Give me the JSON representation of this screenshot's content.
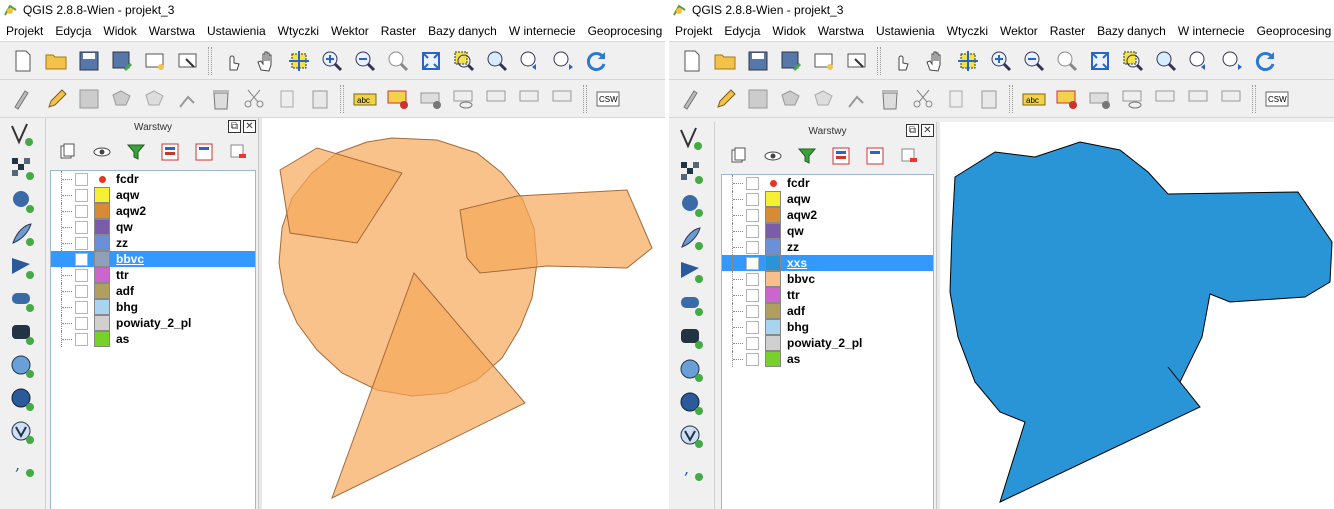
{
  "windows": [
    {
      "title": "QGIS 2.8.8-Wien - projekt_3",
      "menu": [
        "Projekt",
        "Edycja",
        "Widok",
        "Warstwa",
        "Ustawienia",
        "Wtyczki",
        "Wektor",
        "Raster",
        "Bazy danych",
        "W internecie",
        "Geoprocesing",
        "Po"
      ],
      "panel_title": "Warstwy",
      "toolbar_label": "CSW",
      "layers": [
        {
          "name": "fcdr",
          "type": "point",
          "color": "#e8351c",
          "checked": false,
          "selected": false
        },
        {
          "name": "aqw",
          "color": "#f5f034",
          "checked": false,
          "selected": false
        },
        {
          "name": "aqw2",
          "color": "#d88b35",
          "checked": false,
          "selected": false
        },
        {
          "name": "qw",
          "color": "#7b5ca8",
          "checked": false,
          "selected": false
        },
        {
          "name": "zz",
          "color": "#6b8fd8",
          "checked": false,
          "selected": false
        },
        {
          "name": "bbvc",
          "color": "#8fa0b8",
          "checked": true,
          "selected": true
        },
        {
          "name": "ttr",
          "color": "#cc66cc",
          "checked": false,
          "selected": false
        },
        {
          "name": "adf",
          "color": "#b0a060",
          "checked": false,
          "selected": false
        },
        {
          "name": "bhg",
          "color": "#a8d4f0",
          "checked": false,
          "selected": false
        },
        {
          "name": "powiaty_2_pl",
          "color": "#d0d0d0",
          "checked": false,
          "selected": false
        },
        {
          "name": "as",
          "color": "#77d12a",
          "checked": false,
          "selected": false
        }
      ],
      "fill_color": "#f7a85a"
    },
    {
      "title": "QGIS 2.8.8-Wien - projekt_3",
      "menu": [
        "Projekt",
        "Edycja",
        "Widok",
        "Warstwa",
        "Ustawienia",
        "Wtyczki",
        "Wektor",
        "Raster",
        "Bazy danych",
        "W internecie",
        "Geoprocesing",
        "Po"
      ],
      "panel_title": "Warstwy",
      "toolbar_label": "CSW",
      "layers": [
        {
          "name": "fcdr",
          "type": "point",
          "color": "#e8351c",
          "checked": false,
          "selected": false
        },
        {
          "name": "aqw",
          "color": "#f5f034",
          "checked": false,
          "selected": false
        },
        {
          "name": "aqw2",
          "color": "#d88b35",
          "checked": false,
          "selected": false
        },
        {
          "name": "qw",
          "color": "#7b5ca8",
          "checked": false,
          "selected": false
        },
        {
          "name": "zz",
          "color": "#6b8fd8",
          "checked": false,
          "selected": false
        },
        {
          "name": "xxs",
          "color": "#2a95d6",
          "checked": true,
          "selected": true
        },
        {
          "name": "bbvc",
          "color": "#f7c08a",
          "checked": false,
          "selected": false
        },
        {
          "name": "ttr",
          "color": "#cc66cc",
          "checked": false,
          "selected": false
        },
        {
          "name": "adf",
          "color": "#b0a060",
          "checked": false,
          "selected": false
        },
        {
          "name": "bhg",
          "color": "#a8d4f0",
          "checked": false,
          "selected": false
        },
        {
          "name": "powiaty_2_pl",
          "color": "#d0d0d0",
          "checked": false,
          "selected": false
        },
        {
          "name": "as",
          "color": "#77d12a",
          "checked": false,
          "selected": false
        }
      ],
      "fill_color": "#2a95d6"
    }
  ]
}
